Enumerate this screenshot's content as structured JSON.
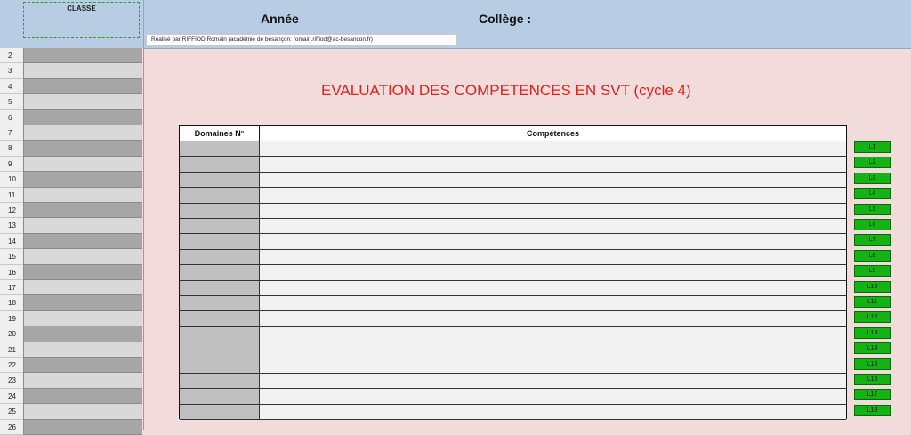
{
  "header": {
    "classe_label": "CLASSE",
    "annee_label": "Année",
    "college_label": "Collège :",
    "credit": "Réalisé par  RIFFIOD Romain (académie de besançon: romain.riffiod@ac-besancon.fr) ."
  },
  "title": "EVALUATION  DES COMPETENCES EN SVT (cycle 4)",
  "table": {
    "col_domaines": "Domaines N°",
    "col_competences": "Compétences"
  },
  "row_numbers": [
    "2",
    "3",
    "4",
    "5",
    "6",
    "7",
    "8",
    "9",
    "10",
    "11",
    "12",
    "13",
    "14",
    "15",
    "16",
    "17",
    "18",
    "19",
    "20",
    "21",
    "22",
    "23",
    "24",
    "25",
    "26"
  ],
  "buttons": [
    "L1",
    "L2",
    "L3",
    "L4",
    "L5",
    "L6",
    "L7",
    "L8",
    "L9",
    "L10",
    "L11",
    "L12",
    "L13",
    "L14",
    "L15",
    "L16",
    "L17",
    "L18"
  ],
  "colors": {
    "header_bg": "#b8cce4",
    "page_bg": "#f2dcdb",
    "title_red": "#e0201a",
    "button_green": "#14b214"
  }
}
